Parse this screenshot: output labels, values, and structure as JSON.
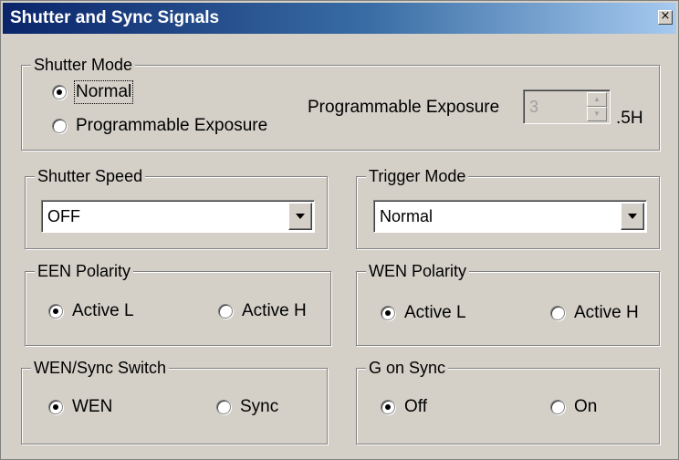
{
  "window": {
    "title": "Shutter and Sync Signals",
    "close_glyph": "×"
  },
  "shutter_mode": {
    "legend": "Shutter Mode",
    "options": [
      {
        "label": "Normal",
        "checked": true
      },
      {
        "label": "Programmable Exposure",
        "checked": false
      }
    ],
    "exposure_label": "Programmable Exposure",
    "exposure_value": "3",
    "exposure_unit": ".5H",
    "spin_up": "▲",
    "spin_down": "▼"
  },
  "shutter_speed": {
    "legend": "Shutter Speed",
    "selected": "OFF"
  },
  "trigger_mode": {
    "legend": "Trigger Mode",
    "selected": "Normal"
  },
  "een_polarity": {
    "legend": "EEN Polarity",
    "options": [
      {
        "label": "Active L",
        "checked": true
      },
      {
        "label": "Active H",
        "checked": false
      }
    ]
  },
  "wen_polarity": {
    "legend": "WEN Polarity",
    "options": [
      {
        "label": "Active L",
        "checked": true
      },
      {
        "label": "Active H",
        "checked": false
      }
    ]
  },
  "wen_sync_switch": {
    "legend": "WEN/Sync Switch",
    "options": [
      {
        "label": "WEN",
        "checked": true
      },
      {
        "label": "Sync",
        "checked": false
      }
    ]
  },
  "g_on_sync": {
    "legend": "G on Sync",
    "options": [
      {
        "label": "Off",
        "checked": true
      },
      {
        "label": "On",
        "checked": false
      }
    ]
  }
}
